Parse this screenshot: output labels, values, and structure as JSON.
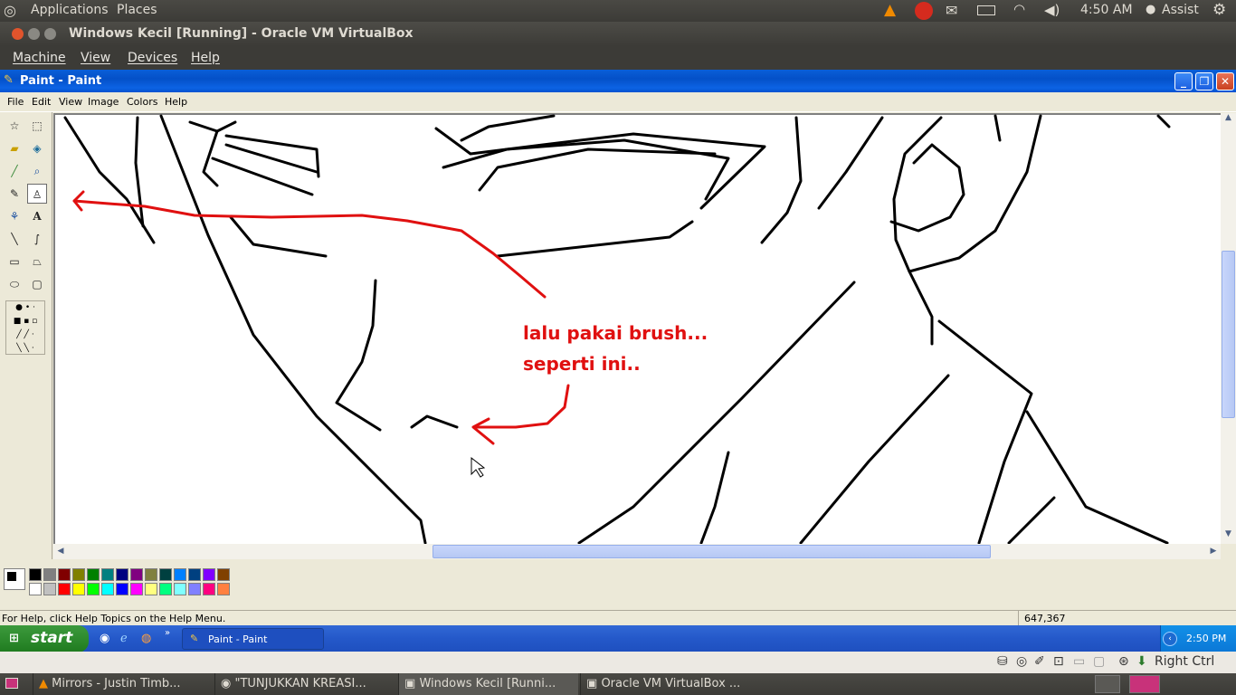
{
  "top_panel": {
    "applications": "Applications",
    "places": "Places",
    "time": "4:50 AM",
    "user": "Assist"
  },
  "vbox": {
    "title": "Windows Kecil [Running] - Oracle VM VirtualBox",
    "menu": [
      "Machine",
      "View",
      "Devices",
      "Help"
    ],
    "host_key": "Right Ctrl"
  },
  "paint": {
    "title": "Paint - Paint",
    "menu": [
      "File",
      "Edit",
      "View",
      "Image",
      "Colors",
      "Help"
    ],
    "status_help": "For Help, click Help Topics on the Help Menu.",
    "coords": "647,367",
    "annotation_line1": "lalu pakai brush...",
    "annotation_line2": "seperti ini..",
    "palette_row1": [
      "#000000",
      "#808080",
      "#800000",
      "#808000",
      "#008000",
      "#008080",
      "#000080",
      "#800080",
      "#808040",
      "#004040",
      "#0080ff",
      "#004080",
      "#8000ff",
      "#804000"
    ],
    "palette_row2": [
      "#ffffff",
      "#c0c0c0",
      "#ff0000",
      "#ffff00",
      "#00ff00",
      "#00ffff",
      "#0000ff",
      "#ff00ff",
      "#ffff80",
      "#00ff80",
      "#80ffff",
      "#8080ff",
      "#ff0080",
      "#ff8040"
    ]
  },
  "xp": {
    "start": "start",
    "task": "Paint - Paint",
    "clock": "2:50 PM"
  },
  "bottom_panel": {
    "tasks": [
      "Mirrors - Justin Timb...",
      "\"TUNJUKKAN KREASI...",
      "Windows Kecil [Runni...",
      "Oracle VM VirtualBox ..."
    ]
  }
}
